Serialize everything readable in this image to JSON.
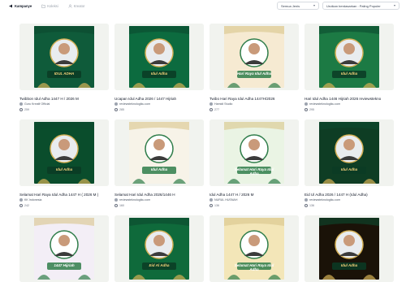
{
  "tabs": [
    {
      "label": "Kampanye",
      "active": true,
      "icon": "megaphone-icon"
    },
    {
      "label": "Koleksi",
      "active": false,
      "icon": "folder-icon"
    },
    {
      "label": "Kreator",
      "active": false,
      "icon": "user-icon"
    }
  ],
  "filters": {
    "type_label": "Semua Jenis",
    "sort_label": "Urutkan berdasarkan : Paling Populer"
  },
  "cards": [
    {
      "title": "Twibbon Idul Adha 1447 H / 2026 M",
      "author": "Guru Kreatif Official",
      "supporters": "259",
      "bg": "#0f5b3a",
      "frame_text": "IDUL ADHA"
    },
    {
      "title": "Ucapan Idul Adha 2026 / 1447 Hijriah",
      "author": "reviewsteknologiku.com",
      "supporters": "285",
      "bg": "#0c6b3f",
      "frame_text": "Idul Adha"
    },
    {
      "title": "Twibo Hari Raya Idul Adha 1447H/2026",
      "author": "Hamidi Studio",
      "supporters": "277",
      "bg": "#f6ead2",
      "frame_text": "Hari Raya Idul Adha"
    },
    {
      "title": "Hari Idul Adha 1446 Hijriah 2026 reviewstekno",
      "author": "reviewsteknologiku.com",
      "supporters": "295",
      "bg": "#1c7a44",
      "frame_text": "Idul Adha"
    },
    {
      "title": "Selamat Hari Raya Idul Adha 1447 H ( 2026 M )",
      "author": "KK Indonesia",
      "supporters": "242",
      "bg": "#0a4d2c",
      "frame_text": "Idul Adha"
    },
    {
      "title": "Selamat Hari Idul Adha 2026/1446 H",
      "author": "reviewsteknologiku.com",
      "supporters": "160",
      "bg": "#f7f3e8",
      "frame_text": "Idul Adha"
    },
    {
      "title": "Idul Adha 1447 H / 2026 M",
      "author": "NURUL HUSNAH",
      "supporters": "136",
      "bg": "#eaf4e4",
      "frame_text": "Selamat Hari Raya Idul Adha"
    },
    {
      "title": "Eid Ul Adha 2026 / 1447 H (Idul Adha)",
      "author": "reviewsteknologiku.com",
      "supporters": "136",
      "bg": "#0e3d24",
      "frame_text": "Idul Adha"
    },
    {
      "title": "",
      "author": "",
      "supporters": "",
      "bg": "#f3eef6",
      "frame_text": "1447 Hijriah"
    },
    {
      "title": "",
      "author": "",
      "supporters": "",
      "bg": "#0f6a3b",
      "frame_text": "Eid Al Adha"
    },
    {
      "title": "",
      "author": "",
      "supporters": "",
      "bg": "#f3e6b8",
      "frame_text": "Selamat Hari Raya Idul Adha"
    },
    {
      "title": "",
      "author": "",
      "supporters": "",
      "bg": "#1a1208",
      "frame_text": "Idul Adha"
    }
  ]
}
